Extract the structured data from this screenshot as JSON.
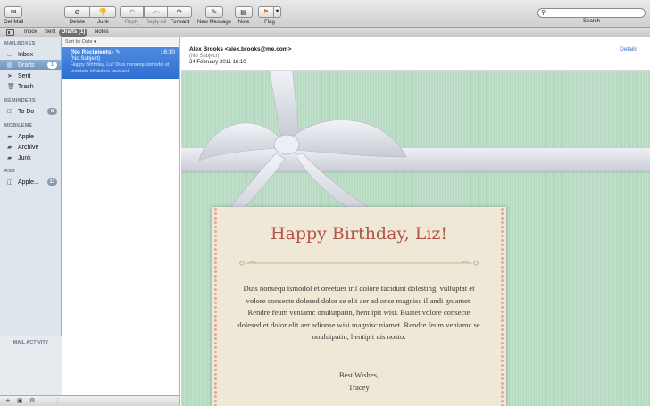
{
  "toolbar": {
    "get_mail": "Get Mail",
    "delete": "Delete",
    "junk": "Junk",
    "reply": "Reply",
    "reply_all": "Reply All",
    "forward": "Forward",
    "new_message": "New Message",
    "note": "Note",
    "flag": "Flag",
    "search_label": "Search",
    "search_placeholder": ""
  },
  "favorites": {
    "inbox": "Inbox",
    "sent": "Sent",
    "drafts": "Drafts (1)",
    "notes": "Notes"
  },
  "sidebar": {
    "mailboxes_header": "MAILBOXES",
    "mailboxes": [
      {
        "label": "Inbox",
        "icon": "inbox-icon"
      },
      {
        "label": "Drafts",
        "icon": "drafts-icon",
        "badge": "1"
      },
      {
        "label": "Sent",
        "icon": "sent-icon"
      },
      {
        "label": "Trash",
        "icon": "trash-icon"
      }
    ],
    "reminders_header": "REMINDERS",
    "reminders": [
      {
        "label": "To Do",
        "icon": "todo-icon",
        "badge": "8"
      }
    ],
    "mobileme_header": "MOBILEME",
    "mobileme": [
      {
        "label": "Apple",
        "icon": "folder-icon"
      },
      {
        "label": "Archive",
        "icon": "folder-icon"
      },
      {
        "label": "Junk",
        "icon": "folder-icon"
      }
    ],
    "rss_header": "RSS",
    "rss": [
      {
        "label": "Apple...",
        "icon": "rss-icon",
        "badge": "17"
      }
    ],
    "mail_activity": "MAIL ACTIVITY"
  },
  "message_list": {
    "sort_label": "Sort by Date",
    "messages": [
      {
        "from": "(No Recipients)",
        "time": "16:10",
        "subject": "(No Subject)",
        "preview": "Happy Birthday, Liz! Duis nonsequ ismodol et oreetuer iril dolore facidunt"
      }
    ]
  },
  "reader": {
    "from": "Alex Brooks <alex.brooks@me.com>",
    "subject": "(No Subject)",
    "date": "24 February 2011 16:10",
    "details": "Details",
    "card_title": "Happy Birthday, Liz!",
    "card_body": "Duis nonsequ ismodol et oreetuer iril dolore facidunt dolesting, vulluptat et volore consecte dolesed dolor se elit aer adionse magnisc illandi gniamet. Rendre feum veniamc onulutpatin, hent ipit wisi. Buatet volore consecte dolesed et dolor elit aer adionse wisi magnisc niamet. Rendre feum veniamc se onulutpatin, hentipit uis nosto.",
    "signoff": "Best Wishes,",
    "signature": "Tracey"
  },
  "colors": {
    "selection_blue": "#2f6fd1",
    "stationery_green": "#b6dbc2",
    "card_paper": "#f0e8d6",
    "title_red": "#b45346"
  }
}
